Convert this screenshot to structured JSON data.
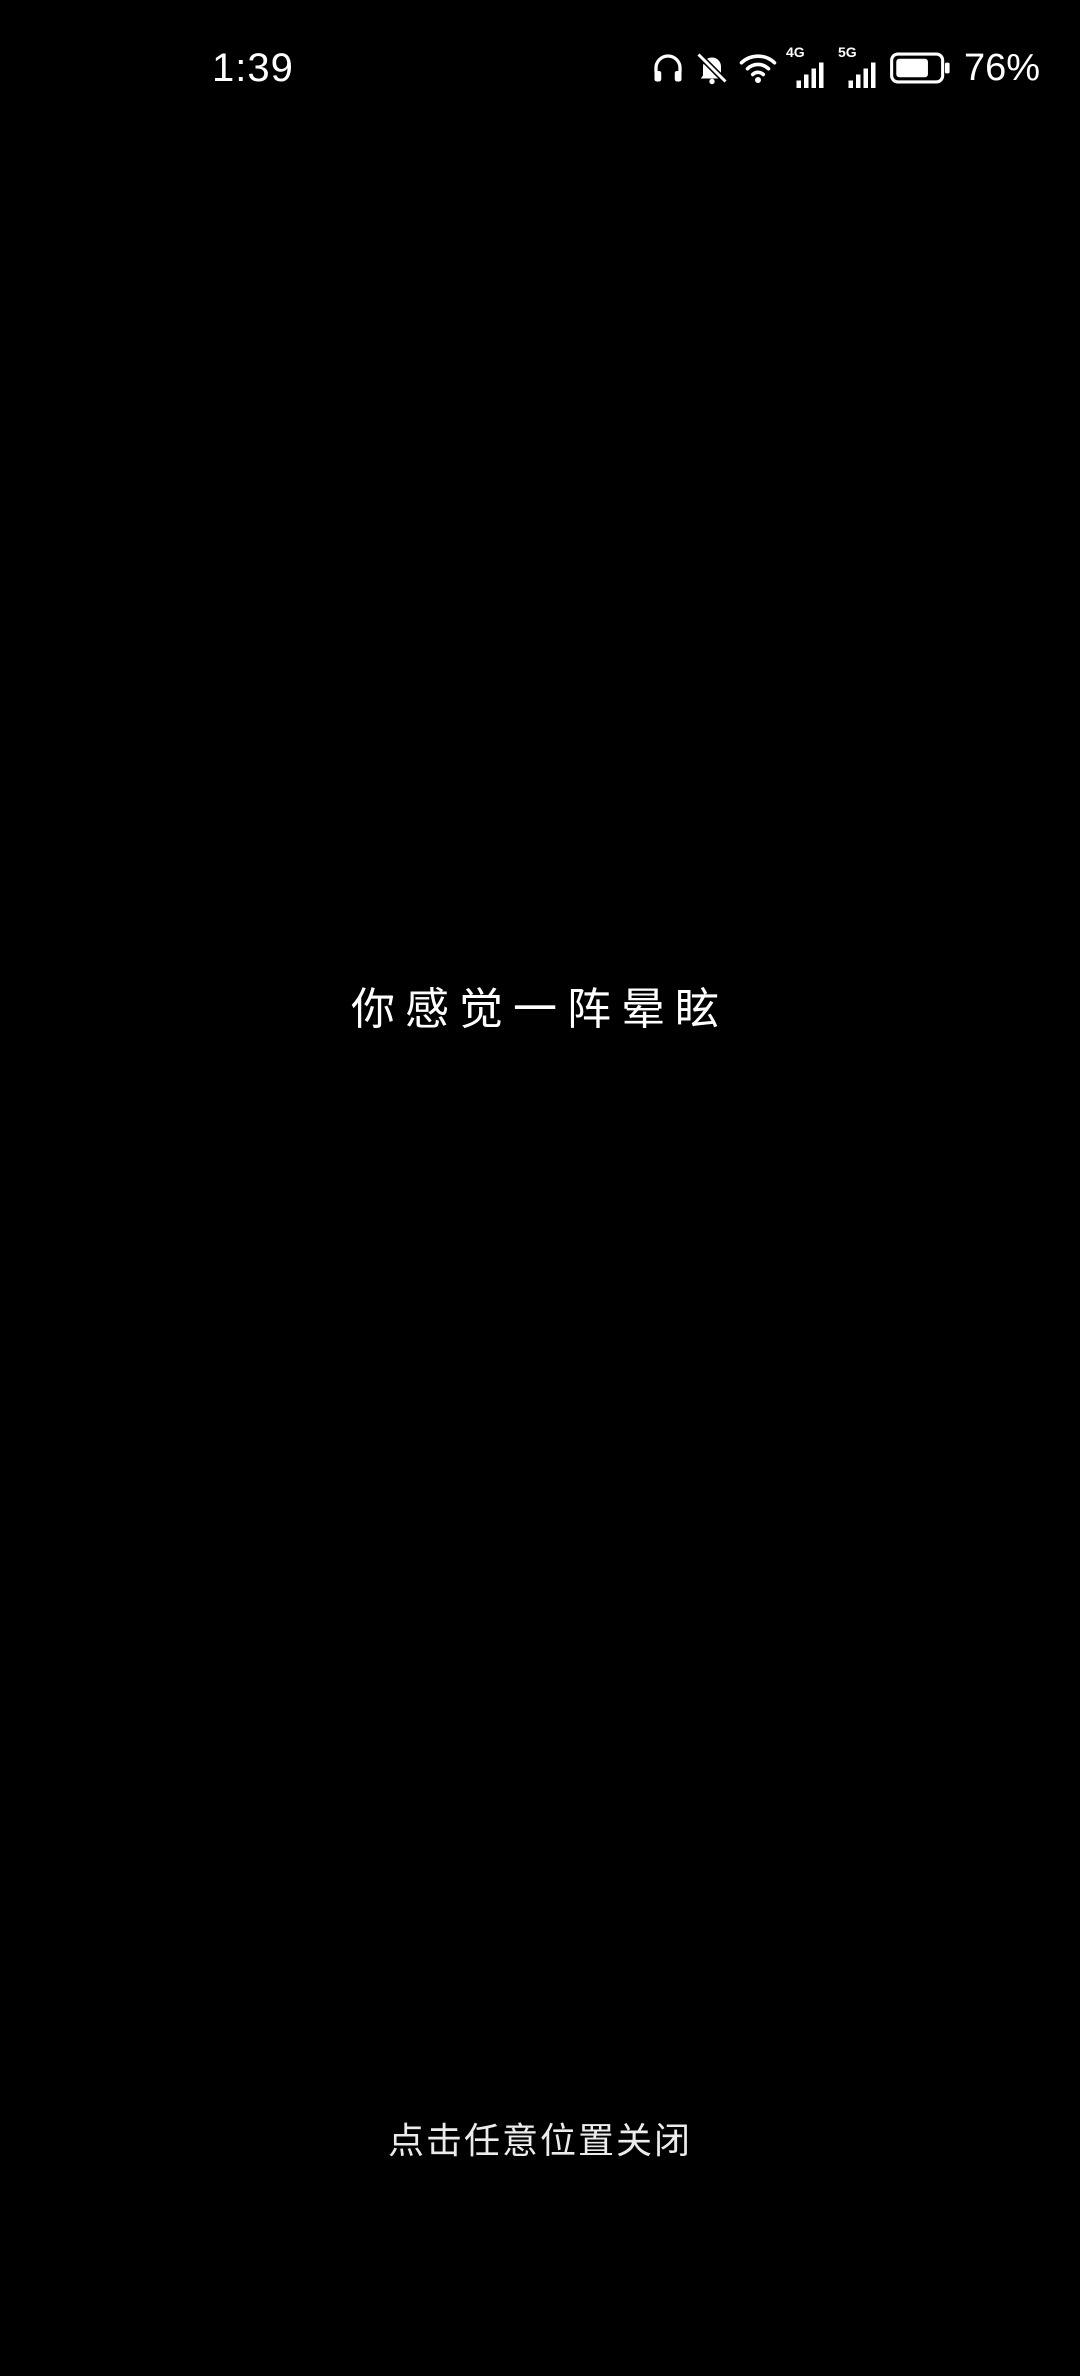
{
  "status_bar": {
    "time": "1:39",
    "icons": [
      "headphones-icon",
      "bell-muted-icon",
      "wifi-icon",
      "signal-4g-icon",
      "signal-5g-icon",
      "battery-icon"
    ],
    "network_1": "4G",
    "network_2": "5G",
    "battery_percent": "76%",
    "battery_level": 0.76
  },
  "dialog": {
    "message": "你感觉一阵晕眩",
    "close_hint": "点击任意位置关闭"
  },
  "colors": {
    "background": "#000000",
    "text": "#ffffff"
  }
}
